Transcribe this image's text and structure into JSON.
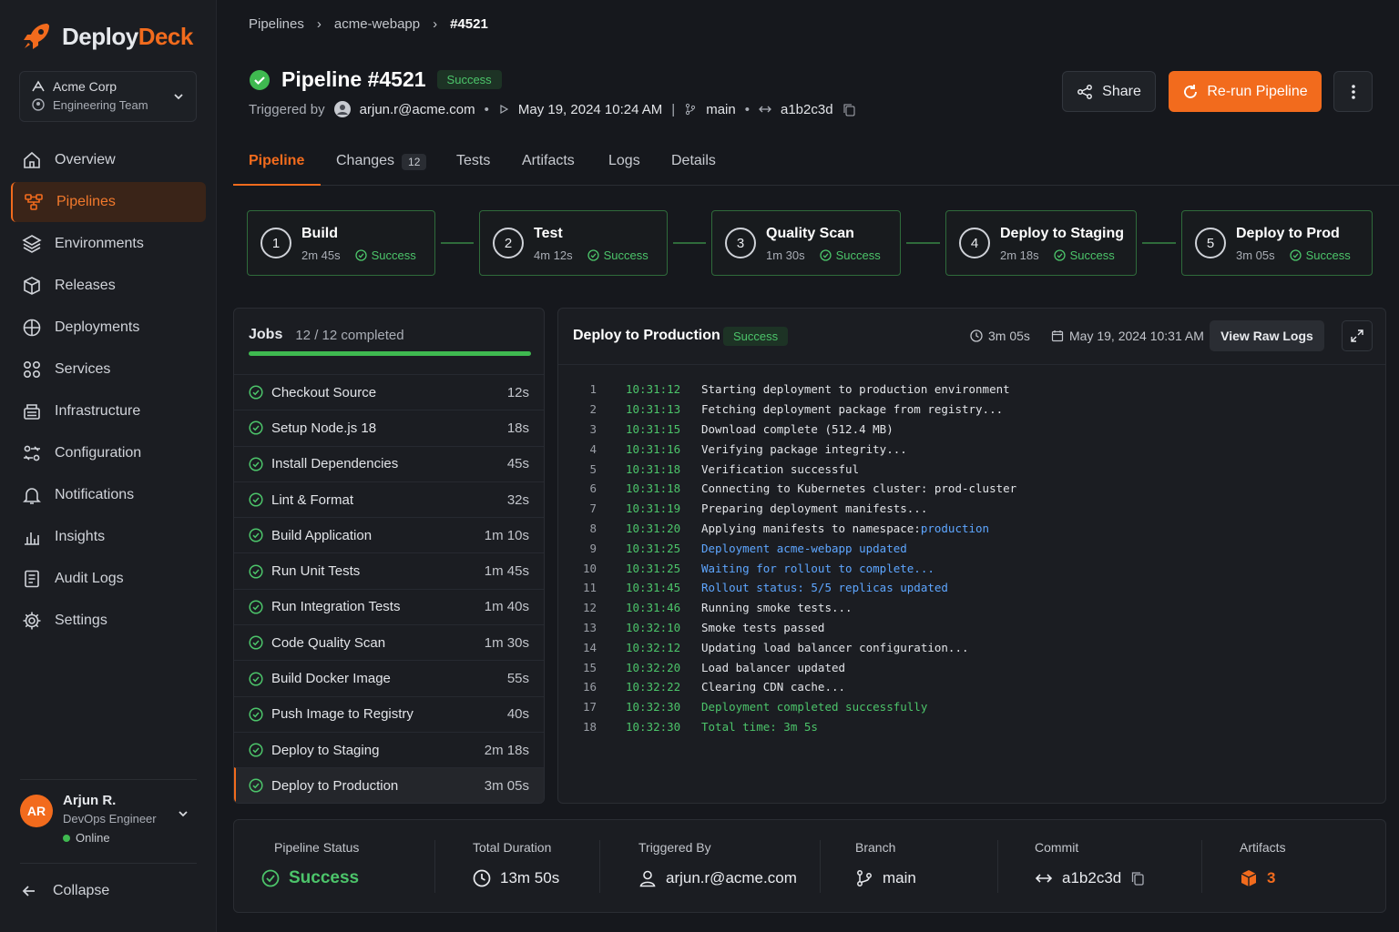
{
  "app": {
    "name_part1": "Deploy",
    "name_part2": "Deck",
    "brand_color": "#f26b1d"
  },
  "org": {
    "name": "Acme Corp",
    "team": "Engineering Team"
  },
  "nav": [
    {
      "label": "Overview",
      "icon": "home-icon"
    },
    {
      "label": "Pipelines",
      "icon": "pipelines-icon",
      "active": true
    },
    {
      "label": "Environments",
      "icon": "layers-icon"
    },
    {
      "label": "Releases",
      "icon": "package-icon"
    },
    {
      "label": "Deployments",
      "icon": "deploy-icon"
    },
    {
      "label": "Services",
      "icon": "services-icon"
    },
    {
      "label": "Infrastructure",
      "icon": "server-icon"
    },
    {
      "label": "Configuration",
      "icon": "config-icon"
    },
    {
      "label": "Notifications",
      "icon": "bell-icon"
    },
    {
      "label": "Insights",
      "icon": "chart-icon"
    },
    {
      "label": "Audit Logs",
      "icon": "file-icon"
    },
    {
      "label": "Settings",
      "icon": "gear-icon"
    }
  ],
  "user": {
    "initials": "AR",
    "name": "Arjun R.",
    "role": "DevOps Engineer",
    "status": "Online"
  },
  "collapse_label": "Collapse",
  "breadcrumb": [
    "Pipelines",
    "acme-webapp",
    "#4521"
  ],
  "pipeline": {
    "title": "Pipeline #4521",
    "status": "Success",
    "triggered_label": "Triggered by",
    "triggered_by": "arjun.r@acme.com",
    "date": "May 19, 2024 10:24 AM",
    "branch": "main",
    "commit": "a1b2c3d"
  },
  "actions": {
    "share": "Share",
    "rerun": "Re-run Pipeline"
  },
  "tabs": [
    {
      "label": "Pipeline",
      "active": true
    },
    {
      "label": "Changes",
      "count": "12"
    },
    {
      "label": "Tests"
    },
    {
      "label": "Artifacts"
    },
    {
      "label": "Logs"
    },
    {
      "label": "Details"
    }
  ],
  "stages": [
    {
      "num": "1",
      "name": "Build",
      "duration": "2m 45s",
      "status": "Success"
    },
    {
      "num": "2",
      "name": "Test",
      "duration": "4m 12s",
      "status": "Success"
    },
    {
      "num": "3",
      "name": "Quality Scan",
      "duration": "1m 30s",
      "status": "Success"
    },
    {
      "num": "4",
      "name": "Deploy to Staging",
      "duration": "2m 18s",
      "status": "Success"
    },
    {
      "num": "5",
      "name": "Deploy to Prod",
      "duration": "3m 05s",
      "status": "Success"
    }
  ],
  "jobs": {
    "title": "Jobs",
    "count": "12 / 12 completed",
    "progress": 1.0,
    "items": [
      {
        "name": "Checkout Source",
        "duration": "12s"
      },
      {
        "name": "Setup Node.js 18",
        "duration": "18s"
      },
      {
        "name": "Install Dependencies",
        "duration": "45s"
      },
      {
        "name": "Lint & Format",
        "duration": "32s"
      },
      {
        "name": "Build Application",
        "duration": "1m 10s"
      },
      {
        "name": "Run Unit Tests",
        "duration": "1m 45s"
      },
      {
        "name": "Run Integration Tests",
        "duration": "1m 40s"
      },
      {
        "name": "Code Quality Scan",
        "duration": "1m 30s"
      },
      {
        "name": "Build Docker Image",
        "duration": "55s"
      },
      {
        "name": "Push Image to Registry",
        "duration": "40s"
      },
      {
        "name": "Deploy to Staging",
        "duration": "2m 18s"
      },
      {
        "name": "Deploy to Production",
        "duration": "3m 05s",
        "active": true
      }
    ]
  },
  "logs": {
    "title": "Deploy to Production",
    "status": "Success",
    "duration": "3m 05s",
    "date": "May 19, 2024 10:31 AM",
    "raw_button": "View Raw Logs",
    "lines": [
      {
        "n": "1",
        "t": "10:31:12",
        "m": "Starting deployment to production environment",
        "k": ""
      },
      {
        "n": "2",
        "t": "10:31:13",
        "m": "Fetching deployment package from registry...",
        "k": ""
      },
      {
        "n": "3",
        "t": "10:31:15",
        "m": "Download complete (512.4 MB)",
        "k": ""
      },
      {
        "n": "4",
        "t": "10:31:16",
        "m": "Verifying package integrity...",
        "k": ""
      },
      {
        "n": "5",
        "t": "10:31:18",
        "m": "Verification successful",
        "k": ""
      },
      {
        "n": "6",
        "t": "10:31:18",
        "m": "Connecting to Kubernetes cluster: prod-cluster",
        "k": ""
      },
      {
        "n": "7",
        "t": "10:31:19",
        "m": "Preparing deployment manifests...",
        "k": ""
      },
      {
        "n": "8",
        "t": "10:31:20",
        "m": "Applying manifests to namespace: ",
        "m2": "production",
        "k": ""
      },
      {
        "n": "9",
        "t": "10:31:25",
        "m": "Deployment acme-webapp updated",
        "k": "info"
      },
      {
        "n": "10",
        "t": "10:31:25",
        "m": "Waiting for rollout to complete...",
        "k": "info"
      },
      {
        "n": "11",
        "t": "10:31:45",
        "m": "Rollout status: 5/5 replicas updated",
        "k": "info"
      },
      {
        "n": "12",
        "t": "10:31:46",
        "m": "Running smoke tests...",
        "k": ""
      },
      {
        "n": "13",
        "t": "10:32:10",
        "m": "Smoke tests passed",
        "k": ""
      },
      {
        "n": "14",
        "t": "10:32:12",
        "m": "Updating load balancer configuration...",
        "k": ""
      },
      {
        "n": "15",
        "t": "10:32:20",
        "m": "Load balancer updated",
        "k": ""
      },
      {
        "n": "16",
        "t": "10:32:22",
        "m": "Clearing CDN cache...",
        "k": ""
      },
      {
        "n": "17",
        "t": "10:32:30",
        "m": "Deployment completed successfully",
        "k": "ok"
      },
      {
        "n": "18",
        "t": "10:32:30",
        "m": "Total time: 3m 5s",
        "k": "ok"
      }
    ]
  },
  "summary": {
    "status_label": "Pipeline Status",
    "status_value": "Success",
    "duration_label": "Total Duration",
    "duration_value": "13m 50s",
    "trigger_label": "Triggered By",
    "trigger_value": "arjun.r@acme.com",
    "branch_label": "Branch",
    "branch_value": "main",
    "commit_label": "Commit",
    "commit_value": "a1b2c3d",
    "artifacts_label": "Artifacts",
    "artifacts_value": "3"
  }
}
